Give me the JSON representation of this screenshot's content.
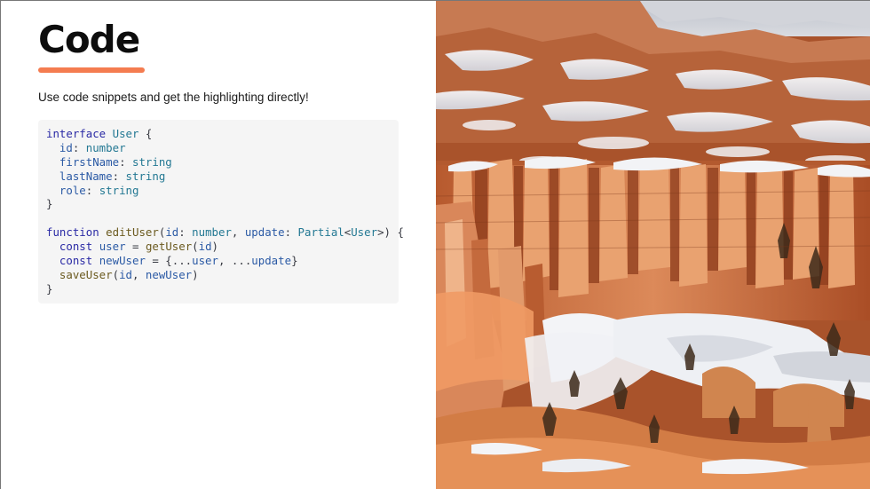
{
  "slide": {
    "title": "Code",
    "subtitle": "Use code snippets and get the highlighting directly!",
    "accent_color": "#f47c50"
  },
  "code": {
    "language": "typescript",
    "lines": [
      [
        {
          "t": "interface",
          "c": "kw"
        },
        {
          "t": " ",
          "c": "pn"
        },
        {
          "t": "User",
          "c": "ty"
        },
        {
          "t": " {",
          "c": "pn"
        }
      ],
      [
        {
          "t": "  ",
          "c": "pn"
        },
        {
          "t": "id",
          "c": "vr"
        },
        {
          "t": ": ",
          "c": "pn"
        },
        {
          "t": "number",
          "c": "ty"
        }
      ],
      [
        {
          "t": "  ",
          "c": "pn"
        },
        {
          "t": "firstName",
          "c": "vr"
        },
        {
          "t": ": ",
          "c": "pn"
        },
        {
          "t": "string",
          "c": "ty"
        }
      ],
      [
        {
          "t": "  ",
          "c": "pn"
        },
        {
          "t": "lastName",
          "c": "vr"
        },
        {
          "t": ": ",
          "c": "pn"
        },
        {
          "t": "string",
          "c": "ty"
        }
      ],
      [
        {
          "t": "  ",
          "c": "pn"
        },
        {
          "t": "role",
          "c": "vr"
        },
        {
          "t": ": ",
          "c": "pn"
        },
        {
          "t": "string",
          "c": "ty"
        }
      ],
      [
        {
          "t": "}",
          "c": "pn"
        }
      ],
      [],
      [
        {
          "t": "function",
          "c": "kw"
        },
        {
          "t": " ",
          "c": "pn"
        },
        {
          "t": "editUser",
          "c": "fn"
        },
        {
          "t": "(",
          "c": "pn"
        },
        {
          "t": "id",
          "c": "vr"
        },
        {
          "t": ": ",
          "c": "pn"
        },
        {
          "t": "number",
          "c": "ty"
        },
        {
          "t": ", ",
          "c": "pn"
        },
        {
          "t": "update",
          "c": "vr"
        },
        {
          "t": ": ",
          "c": "pn"
        },
        {
          "t": "Partial",
          "c": "ty"
        },
        {
          "t": "<",
          "c": "pn"
        },
        {
          "t": "User",
          "c": "ty"
        },
        {
          "t": ">) {",
          "c": "pn"
        }
      ],
      [
        {
          "t": "  ",
          "c": "pn"
        },
        {
          "t": "const",
          "c": "kw"
        },
        {
          "t": " ",
          "c": "pn"
        },
        {
          "t": "user",
          "c": "vr"
        },
        {
          "t": " = ",
          "c": "pn"
        },
        {
          "t": "getUser",
          "c": "fn"
        },
        {
          "t": "(",
          "c": "pn"
        },
        {
          "t": "id",
          "c": "vr"
        },
        {
          "t": ")",
          "c": "pn"
        }
      ],
      [
        {
          "t": "  ",
          "c": "pn"
        },
        {
          "t": "const",
          "c": "kw"
        },
        {
          "t": " ",
          "c": "pn"
        },
        {
          "t": "newUser",
          "c": "vr"
        },
        {
          "t": " = {...",
          "c": "pn"
        },
        {
          "t": "user",
          "c": "vr"
        },
        {
          "t": ", ...",
          "c": "pn"
        },
        {
          "t": "update",
          "c": "vr"
        },
        {
          "t": "}",
          "c": "pn"
        }
      ],
      [
        {
          "t": "  ",
          "c": "pn"
        },
        {
          "t": "saveUser",
          "c": "fn"
        },
        {
          "t": "(",
          "c": "pn"
        },
        {
          "t": "id",
          "c": "vr"
        },
        {
          "t": ", ",
          "c": "pn"
        },
        {
          "t": "newUser",
          "c": "vr"
        },
        {
          "t": ")",
          "c": "pn"
        }
      ],
      [
        {
          "t": "}",
          "c": "pn"
        }
      ]
    ]
  },
  "image": {
    "subject": "snow-dusted-canyon-hoodoos-photo",
    "colors": {
      "sky": "#c9cbd3",
      "snow": "#eef0f4",
      "rock_light": "#e8a276",
      "rock_mid": "#cf7444",
      "rock_dark": "#8f3f1f",
      "shadow": "#4f2a1a"
    }
  }
}
